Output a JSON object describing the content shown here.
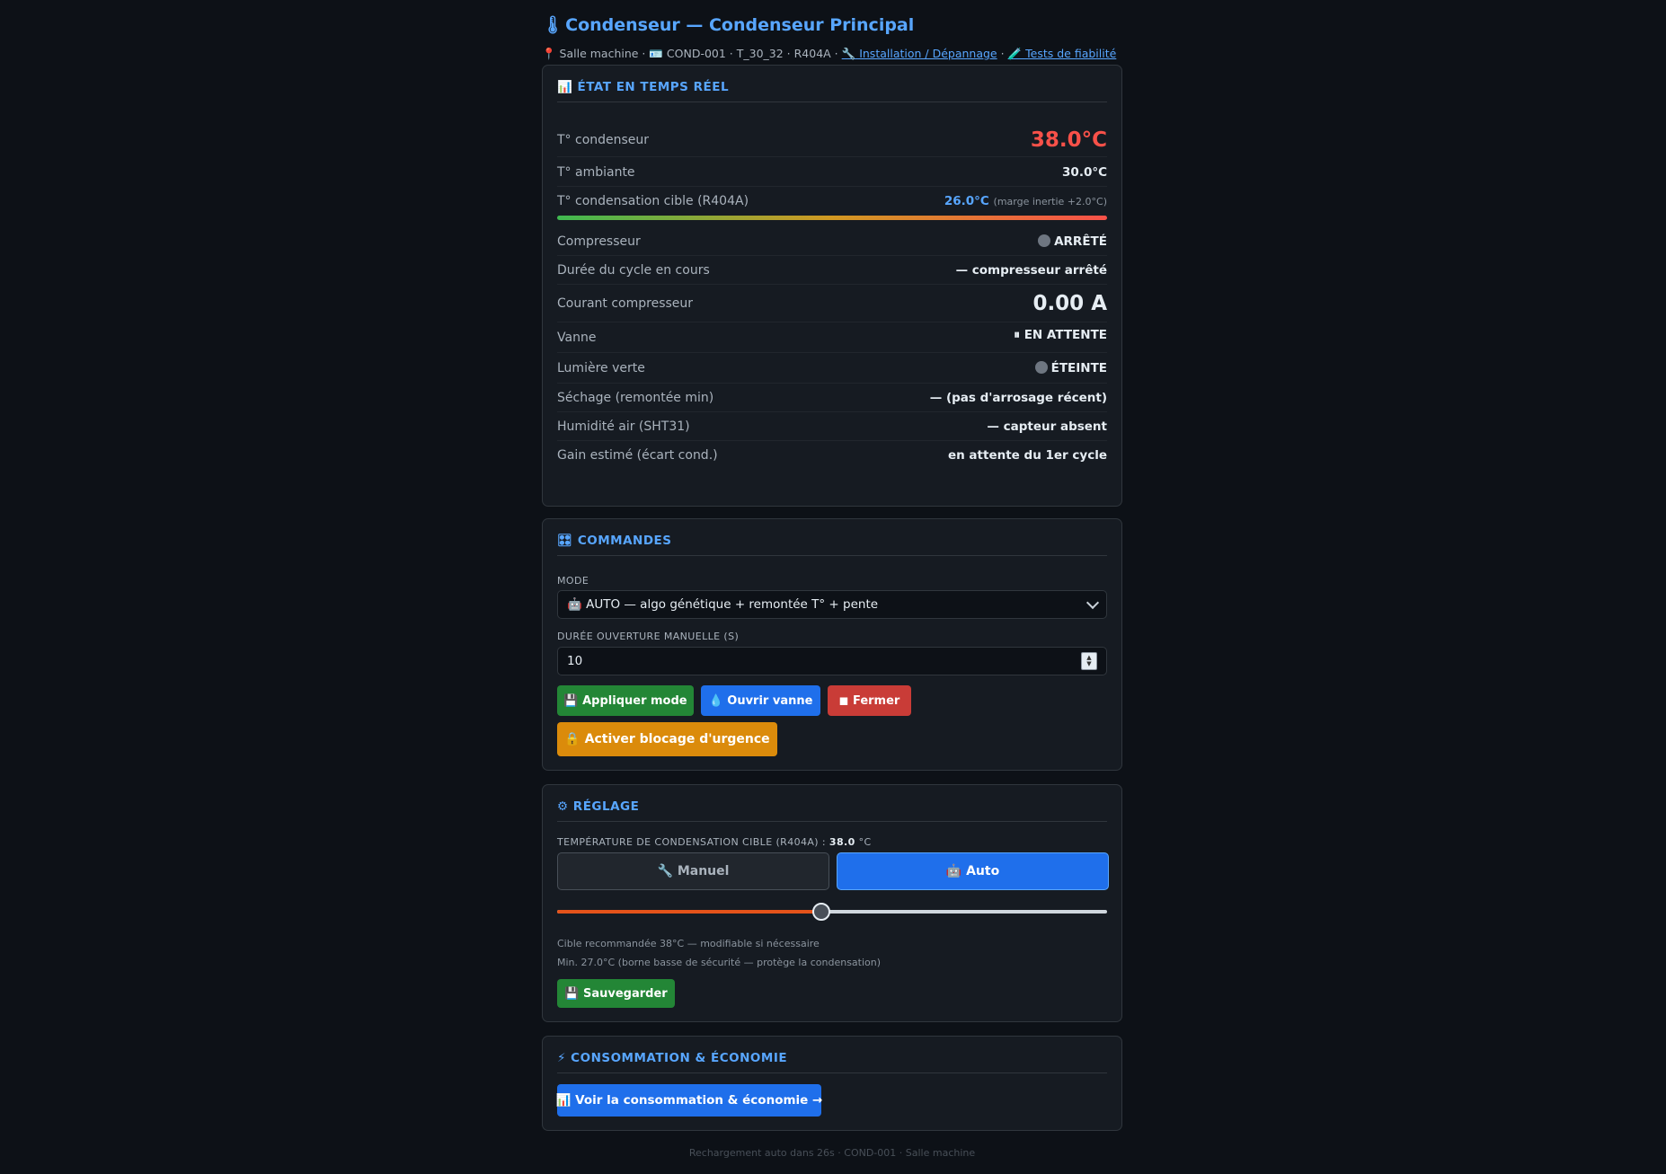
{
  "header": {
    "icon": "thermometer-icon",
    "title": "Condenseur — Condenseur Principal",
    "location": "📍 Salle machine · 🪪 COND-001 · T_30_32 · R404A ·",
    "link_install": "🔧 Installation / Dépannage",
    "sep": "·",
    "link_tests": "🧪 Tests de fiabilité"
  },
  "realtime": {
    "heading": "📊 ÉTAT EN TEMPS RÉEL",
    "t_cond_label": "T° condenseur",
    "t_cond_value": "38.0°C",
    "t_amb_label": "T° ambiante",
    "t_amb_value": "30.0°C",
    "t_target_label": "T° condensation cible (R404A)",
    "t_target_value": "26.0°C",
    "t_target_note": "(marge inertie +2.0°C)",
    "compressor_label": "Compresseur",
    "compressor_value": "ARRÊTÉ",
    "cycle_label": "Durée du cycle en cours",
    "cycle_value": "— compresseur arrêté",
    "current_label": "Courant compresseur",
    "current_value": "0.00 A",
    "valve_label": "Vanne",
    "valve_value": "⏸ EN ATTENTE",
    "light_label": "Lumière verte",
    "light_value": "ÉTEINTE",
    "drying_label": "Séchage (remontée min)",
    "drying_value": "— (pas d'arrosage récent)",
    "humidity_label": "Humidité air (SHT31)",
    "humidity_value": "— capteur absent",
    "gain_label": "Gain estimé (écart cond.)",
    "gain_value": "en attente du 1er cycle"
  },
  "commands": {
    "heading": "🎛 COMMANDES",
    "mode_label": "MODE",
    "mode_value": "🤖 AUTO — algo génétique + remontée T° + pente",
    "duration_label": "DURÉE OUVERTURE MANUELLE (S)",
    "duration_value": "10",
    "apply_label": "💾 Appliquer mode",
    "open_label": "💧 Ouvrir vanne",
    "close_label": "◼ Fermer",
    "emergency_label": "🔒 Activer blocage d'urgence"
  },
  "settings": {
    "heading": "⚙ RÉGLAGE",
    "target_label": "TEMPÉRATURE DE CONDENSATION CIBLE (R404A) :",
    "target_value": "38.0",
    "target_unit": "°C",
    "manual_label": "🔧 Manuel",
    "auto_label": "🤖 Auto",
    "slider_fraction": 0.48,
    "hint1": "Cible recommandée 38°C — modifiable si nécessaire",
    "hint2": "Min. 27.0°C (borne basse de sécurité — protège la condensation)",
    "save_label": "💾 Sauvegarder"
  },
  "consumption": {
    "heading": "⚡ CONSOMMATION & ÉCONOMIE",
    "button_label": "📊 Voir la consommation & économie →"
  },
  "footer": "Rechargement auto dans 26s · COND-001 · Salle machine"
}
